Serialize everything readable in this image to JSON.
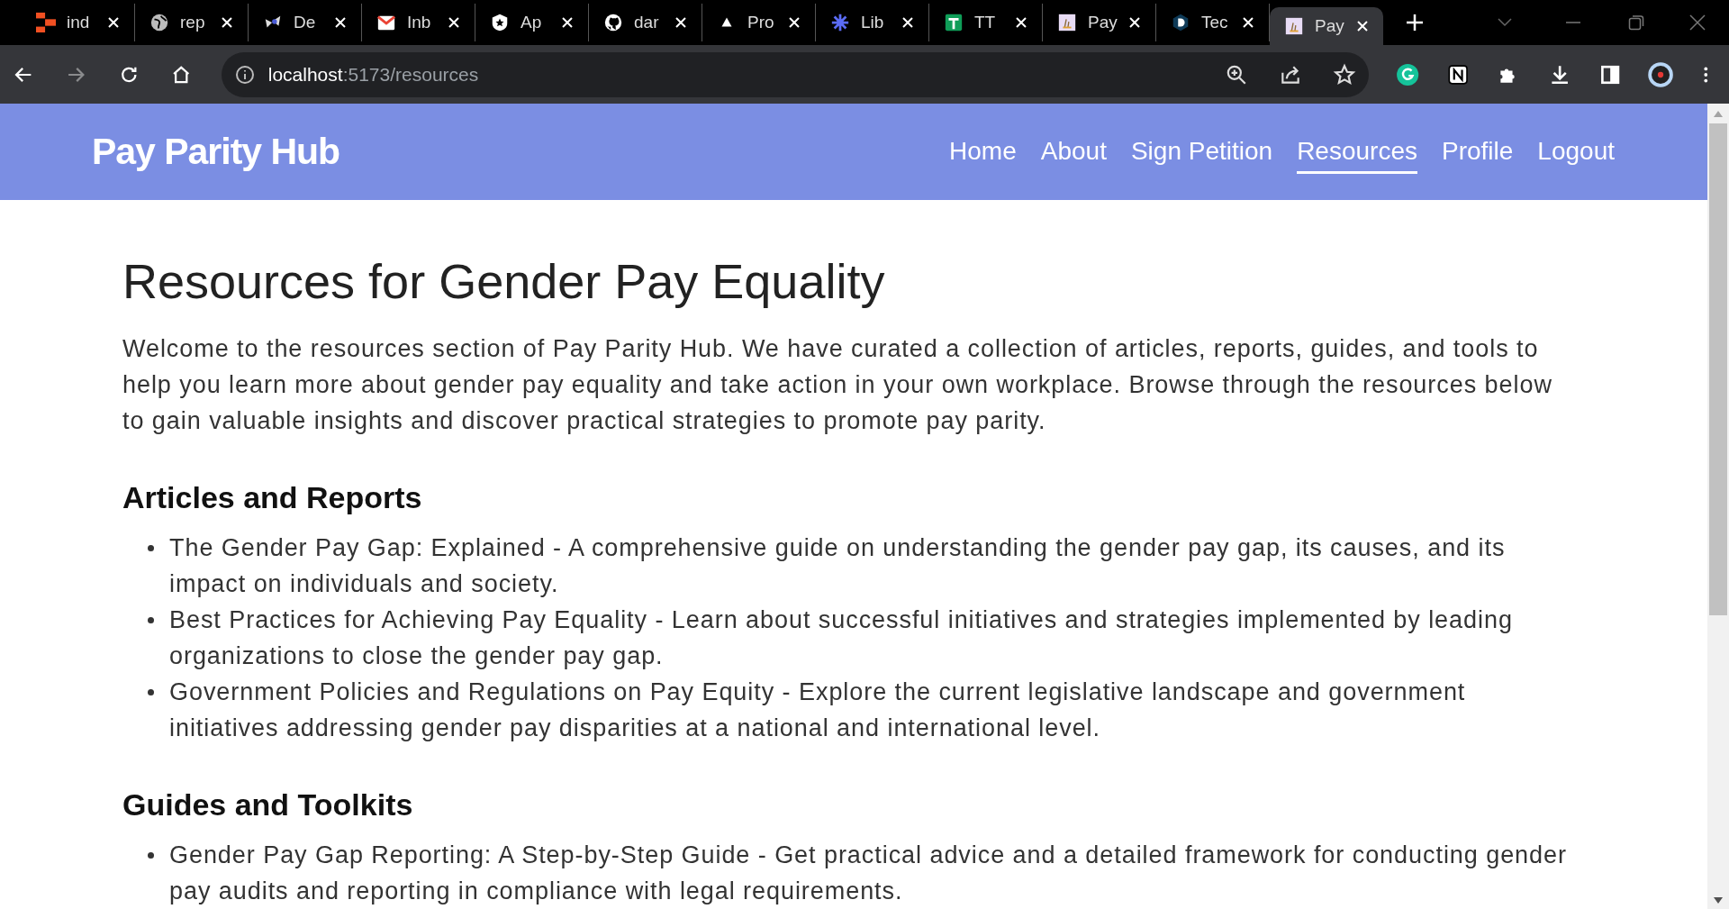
{
  "browser": {
    "tabs": [
      {
        "title": "ind",
        "selected": false
      },
      {
        "title": "rep",
        "selected": false
      },
      {
        "title": "De",
        "selected": false
      },
      {
        "title": "Inb",
        "selected": false
      },
      {
        "title": "Ap",
        "selected": false
      },
      {
        "title": "dar",
        "selected": false
      },
      {
        "title": "Pro",
        "selected": false
      },
      {
        "title": "Lib",
        "selected": false
      },
      {
        "title": "TT",
        "selected": false
      },
      {
        "title": "Pay",
        "selected": false
      },
      {
        "title": "Tec",
        "selected": false
      },
      {
        "title": "Pay",
        "selected": true
      }
    ],
    "address": {
      "host": "localhost",
      "path": ":5173/resources"
    }
  },
  "header": {
    "brand": "Pay Parity Hub",
    "nav": [
      {
        "label": "Home",
        "selected": false
      },
      {
        "label": "About",
        "selected": false
      },
      {
        "label": "Sign Petition",
        "selected": false
      },
      {
        "label": "Resources",
        "selected": true
      },
      {
        "label": "Profile",
        "selected": false
      },
      {
        "label": "Logout",
        "selected": false
      }
    ]
  },
  "page": {
    "title": "Resources for Gender Pay Equality",
    "intro": "Welcome to the resources section of Pay Parity Hub. We have curated a collection of articles, reports, guides, and tools to help you learn more about gender pay equality and take action in your own workplace. Browse through the resources below to gain valuable insights and discover practical strategies to promote pay parity.",
    "sections": [
      {
        "heading": "Articles and Reports",
        "items": [
          "The Gender Pay Gap: Explained - A comprehensive guide on understanding the gender pay gap, its causes, and its impact on individuals and society.",
          "Best Practices for Achieving Pay Equality - Learn about successful initiatives and strategies implemented by leading organizations to close the gender pay gap.",
          "Government Policies and Regulations on Pay Equity - Explore the current legislative landscape and government initiatives addressing gender pay disparities at a national and international level."
        ]
      },
      {
        "heading": "Guides and Toolkits",
        "items": [
          "Gender Pay Gap Reporting: A Step-by-Step Guide - Get practical advice and a detailed framework for conducting gender pay audits and reporting in compliance with legal requirements."
        ]
      }
    ]
  }
}
